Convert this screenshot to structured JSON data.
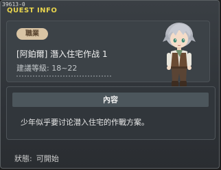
{
  "window": {
    "quest_id": "39613-0",
    "title": "QUEST INFO"
  },
  "quest": {
    "job_label": "職業",
    "name": "[阿鉑爾] 潛入住宅作战 1",
    "level_text": "建議等級: 18~22"
  },
  "content": {
    "header": "內容",
    "description": "少年似乎要讨论潜入住宅的作戰方案。"
  },
  "status": {
    "label": "狀態:",
    "value": "可開始"
  },
  "colors": {
    "title": "#e8d44d",
    "badge": "#d9c4a4",
    "panel": "#3c4247"
  },
  "icons": {
    "portrait": "npc-portrait-silver-hair-boy"
  }
}
